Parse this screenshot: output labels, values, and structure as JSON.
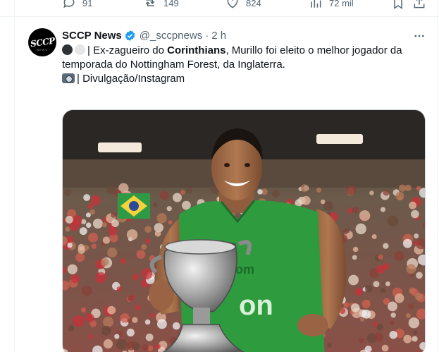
{
  "prev_tweet": {
    "replies": "91",
    "retweets": "149",
    "likes": "824",
    "views": "72 mil"
  },
  "tweet": {
    "name": "SCCP News",
    "handle": "@_sccpnews",
    "separator": "·",
    "time": "2 h",
    "avatar_text": "SCCP",
    "avatar_sub": "NEWS",
    "text_sep": "| Ex-zagueiro do ",
    "text_bold": "Corinthians",
    "text_rest": ", Murillo foi eleito o melhor jogador da temporada do Nottingham Forest, da Inglaterra.",
    "credit": "| Divulgação/Instagram",
    "jersey_text": "on",
    "jersey_text_small": "om"
  },
  "colors": {
    "verified": "#1d9bf0",
    "jersey": "#2e9b3e",
    "crowd_red": "#c8323a"
  },
  "icons": [
    "reply-icon",
    "retweet-icon",
    "like-icon",
    "views-icon",
    "bookmark-icon",
    "share-icon",
    "verified-icon",
    "more-icon",
    "camera-icon"
  ]
}
